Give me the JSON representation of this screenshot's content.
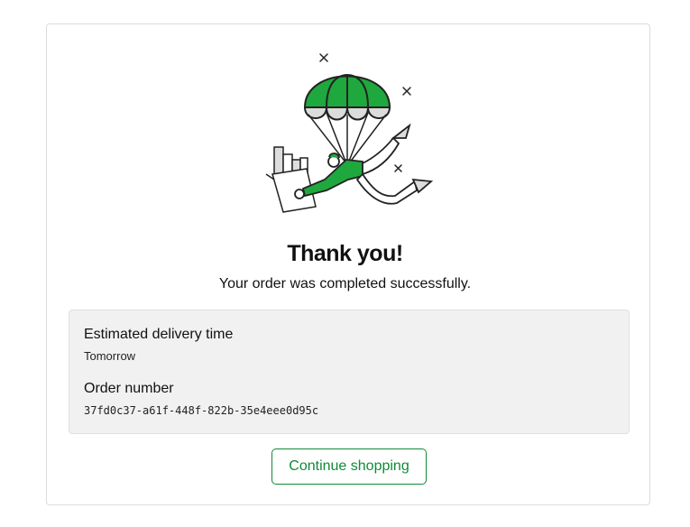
{
  "confirmation": {
    "title": "Thank you!",
    "message": "Your order was completed successfully."
  },
  "details": {
    "delivery_label": "Estimated delivery time",
    "delivery_value": "Tomorrow",
    "order_label": "Order number",
    "order_value": "37fd0c37-a61f-448f-822b-35e4eee0d95c"
  },
  "actions": {
    "continue_label": "Continue shopping"
  },
  "illustration": {
    "icon": "parachute-delivery-illustration",
    "accent_color": "#1fa83d"
  },
  "colors": {
    "brand_green": "#108a37",
    "panel_bg": "#f1f1f1"
  }
}
